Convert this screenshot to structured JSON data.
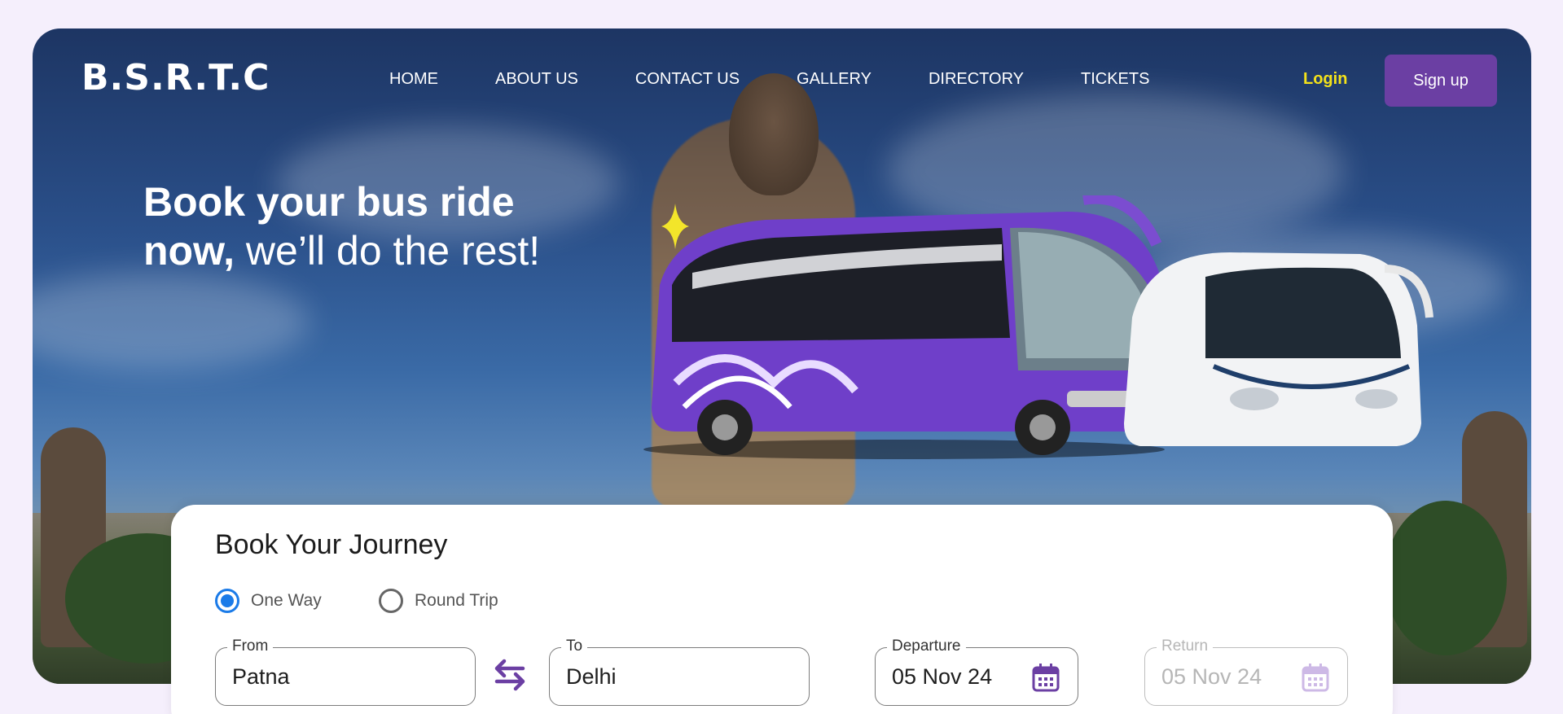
{
  "brand": {
    "logo": "B.S.R.T.C"
  },
  "nav": {
    "items": [
      "HOME",
      "ABOUT US",
      "CONTACT US",
      "GALLERY",
      "DIRECTORY",
      "TICKETS"
    ],
    "login_label": "Login",
    "signup_label": "Sign up"
  },
  "hero": {
    "headline_bold_1": "Book your bus ride",
    "headline_bold_2": "now,",
    "headline_regular": " we’ll do the rest!"
  },
  "booking": {
    "title": "Book Your Journey",
    "trip_types": [
      {
        "label": "One Way",
        "selected": true
      },
      {
        "label": "Round Trip",
        "selected": false
      }
    ],
    "from": {
      "label": "From",
      "value": "Patna"
    },
    "to": {
      "label": "To",
      "value": "Delhi"
    },
    "departure": {
      "label": "Departure",
      "value": "05 Nov 24"
    },
    "return": {
      "label": "Return",
      "value": "05 Nov 24",
      "disabled": true
    }
  },
  "colors": {
    "brand_purple": "#6b3fa3",
    "login_yellow": "#f4e21a",
    "radio_blue": "#1b7be8",
    "page_bg": "#f5effc"
  },
  "icons": [
    "sparkle-icon",
    "swap-arrows-icon",
    "calendar-icon"
  ]
}
